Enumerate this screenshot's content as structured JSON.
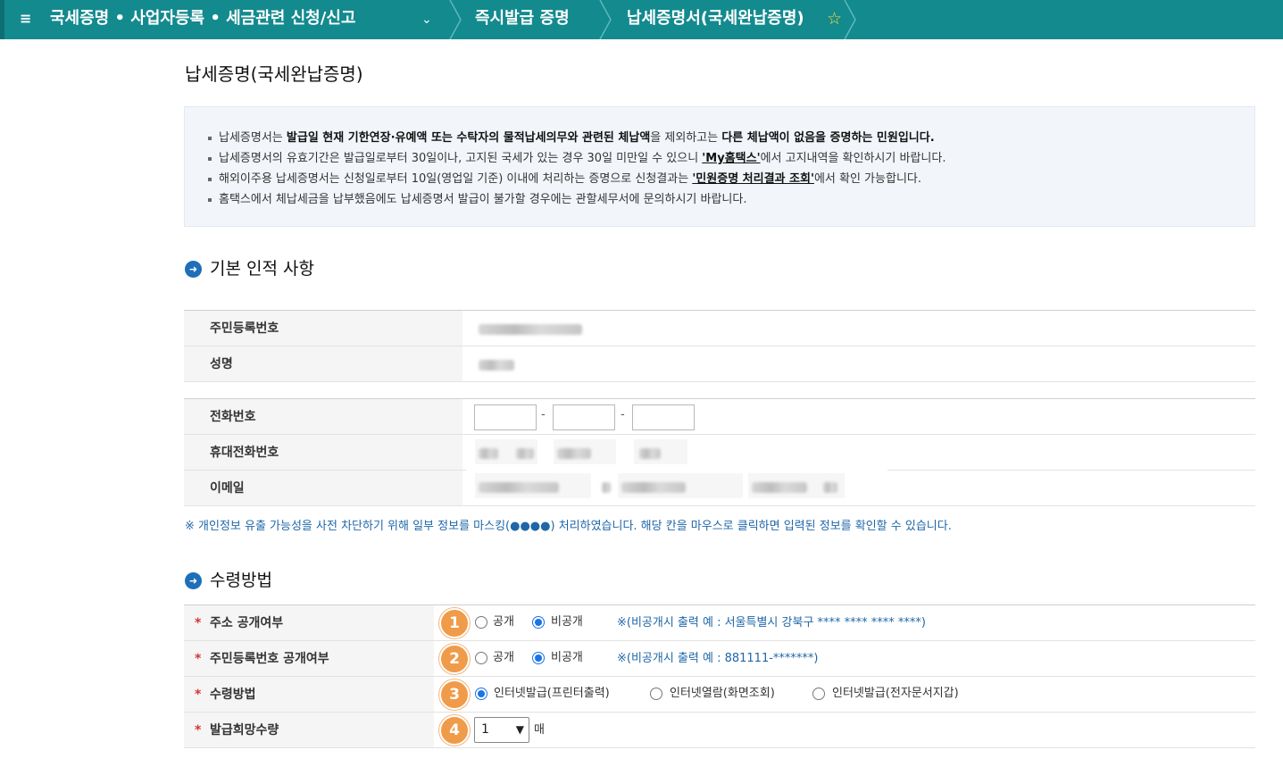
{
  "topbar": {
    "menu_icon": "≡",
    "crumb1": "국세증명 • 사업자등록 • 세금관련 신청/신고",
    "crumb2": "즉시발급 증명",
    "crumb3": "납세증명서(국세완납증명)",
    "star_icon": "☆",
    "chevron_icon": "⌄"
  },
  "page_title": "납세증명(국세완납증명)",
  "notice": {
    "line1_a": "납세증명서는 ",
    "line1_b": "발급일 현재 기한연장·유예액 또는 수탁자의 물적납세의무와 관련된 체납액",
    "line1_c": "을 제외하고는 ",
    "line1_d": "다른 체납액이 없음을 증명하는 민원입니다.",
    "line2_a": "납세증명서의 유효기간은 발급일로부터 30일이나, 고지된 국세가 있는 경우 30일 미만일 수 있으니 ",
    "line2_link": "'My홈택스'",
    "line2_b": "에서 고지내역을 확인하시기 바랍니다.",
    "line3_a": "해외이주용 납세증명서는 신청일로부터 10일(영업일 기준) 이내에 처리하는 증명으로 신청결과는 ",
    "line3_link": "'민원증명 처리결과 조회'",
    "line3_b": "에서 확인 가능합니다.",
    "line4": "홈택스에서 체납세금을 납부했음에도 납세증명서 발급이 불가할 경우에는 관할세무서에 문의하시기 바랍니다."
  },
  "section1": {
    "title": "기본 인적 사항"
  },
  "basic_info": {
    "rrn_label": "주민등록번호",
    "name_label": "성명",
    "phone_label": "전화번호",
    "mobile_label": "휴대전화번호",
    "email_label": "이메일",
    "phone_sep": "-"
  },
  "mask_hint": "※ 개인정보 유출 가능성을 사전 차단하기 위해 일부 정보를 마스킹(●●●●) 처리하였습니다. 해당 칸을 마우스로 클릭하면 입력된 정보를 확인할 수 있습니다.",
  "section2": {
    "title": "수령방법"
  },
  "receive": {
    "required_mark": "*",
    "addr_label": "주소 공개여부",
    "rrn_label": "주민등록번호 공개여부",
    "method_label": "수령방법",
    "qty_label": "발급희망수량",
    "opt_public": "공개",
    "opt_private": "비공개",
    "addr_example": "※(비공개시 출력 예 : 서울특별시 강북구 **** **** **** ****)",
    "rrn_example": "※(비공개시 출력 예 : 881111-*******)",
    "method_opt1": "인터넷발급(프린터출력)",
    "method_opt2": "인터넷열람(화면조회)",
    "method_opt3": "인터넷발급(전자문서지갑)",
    "qty_value": "1",
    "qty_unit": "매",
    "badges": [
      "1",
      "2",
      "3",
      "4"
    ]
  },
  "colors": {
    "topbar": "#138a8e",
    "accent": "#1e6fb8",
    "badge": "#f09b4a",
    "hint": "#1f67a8"
  }
}
